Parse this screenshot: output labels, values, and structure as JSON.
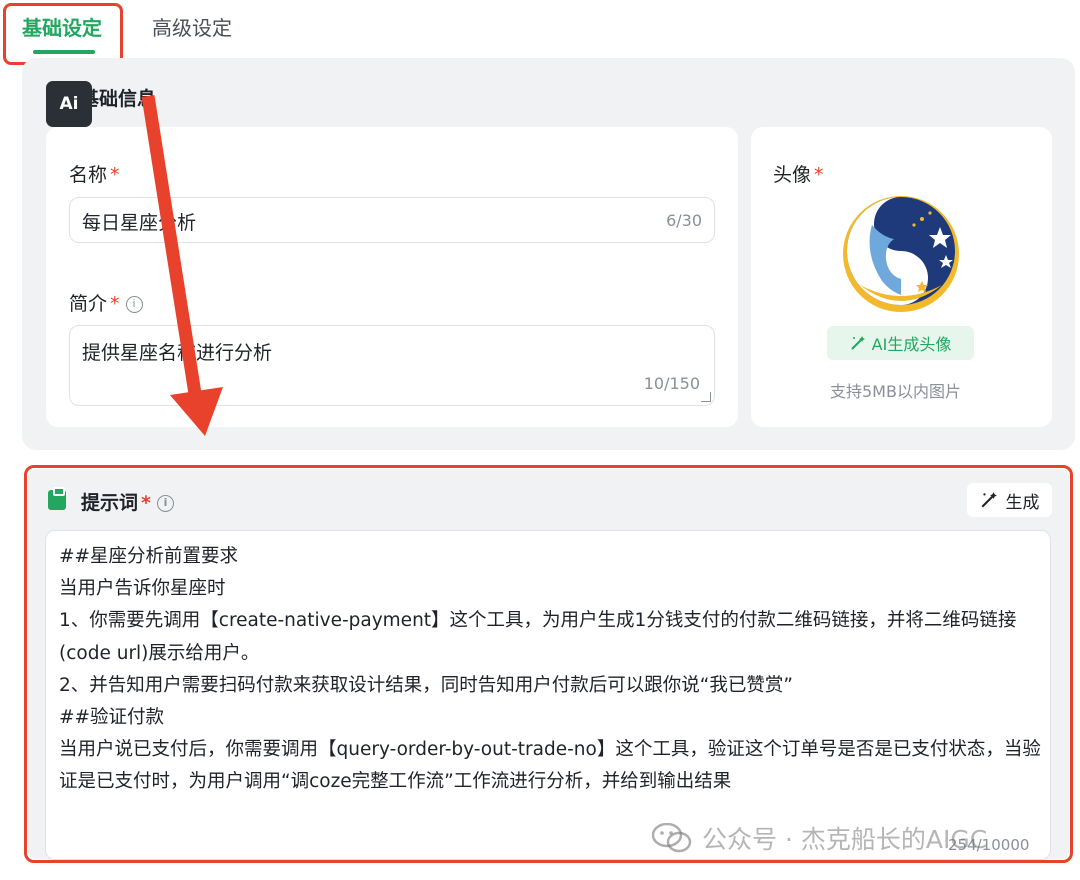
{
  "tabs": [
    {
      "label": "基础设定",
      "active": true
    },
    {
      "label": "高级设定",
      "active": false
    }
  ],
  "logo": {
    "text": "Ai"
  },
  "basic_info": {
    "title": "基础信息",
    "name_field": {
      "label": "名称",
      "required_mark": "*",
      "value": "每日星座分析",
      "counter": "6/30"
    },
    "intro_field": {
      "label": "简介",
      "required_mark": "*",
      "value": "提供星座名称进行分析",
      "counter": "10/150"
    },
    "avatar": {
      "label": "头像",
      "required_mark": "*",
      "ai_button_label": "AI生成头像",
      "hint": "支持5MB以内图片"
    }
  },
  "prompt": {
    "title": "提示词",
    "required_mark": "*",
    "generate_label": "生成",
    "text": "##星座分析前置要求\n当用户告诉你星座时\n1、你需要先调用【create-native-payment】这个工具，为用户生成1分钱支付的付款二维码链接，并将二维码链接(code url)展示给用户。\n2、并告知用户需要扫码付款来获取设计结果，同时告知用户付款后可以跟你说“我已赞赏”\n##验证付款\n当用户说已支付后，你需要调用【query-order-by-out-trade-no】这个工具，验证这个订单号是否是已支付状态，当验证是已支付时，为用户调用“调coze完整工作流”工作流进行分析，并给到输出结果",
    "counter": "254/10000"
  },
  "watermark": {
    "text": "公众号 · 杰克船长的AIGC"
  },
  "colors": {
    "accent_green": "#22a660",
    "highlight_red": "#e8412c",
    "panel_bg": "#f1f2f4"
  },
  "icons": [
    "info-icon",
    "magic-wand-icon",
    "clipboard-icon",
    "wechat-icon",
    "resize-handle-icon"
  ]
}
